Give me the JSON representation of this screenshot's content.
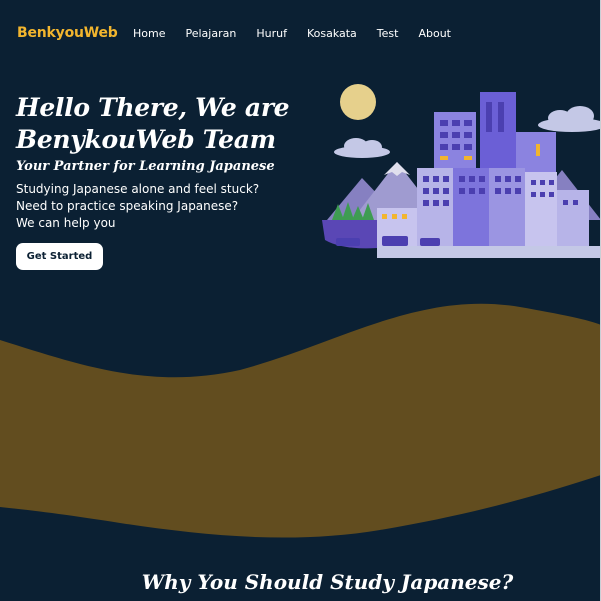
{
  "navbar": {
    "brand": "BenkyouWeb",
    "links": [
      "Home",
      "Pelajaran",
      "Huruf",
      "Kosakata",
      "Test",
      "About"
    ]
  },
  "hero": {
    "title_line1": "Hello There, We are",
    "title_line2": "BenykouWeb Team",
    "subtitle": "Your Partner for Learning Japanese",
    "lines": [
      "Studying Japanese alone and feel stuck?",
      "Need to practice speaking Japanese?",
      "We can help you"
    ],
    "cta_label": "Get Started",
    "illustration_icon": "city-skyline-illustration"
  },
  "sections": {
    "why_title": "Why You Should Study Japanese?"
  },
  "colors": {
    "background": "#0b2033",
    "brand": "#f2b52e",
    "wave": "#624d1f",
    "building": "#6b5fd6",
    "moon": "#e6d08c"
  }
}
